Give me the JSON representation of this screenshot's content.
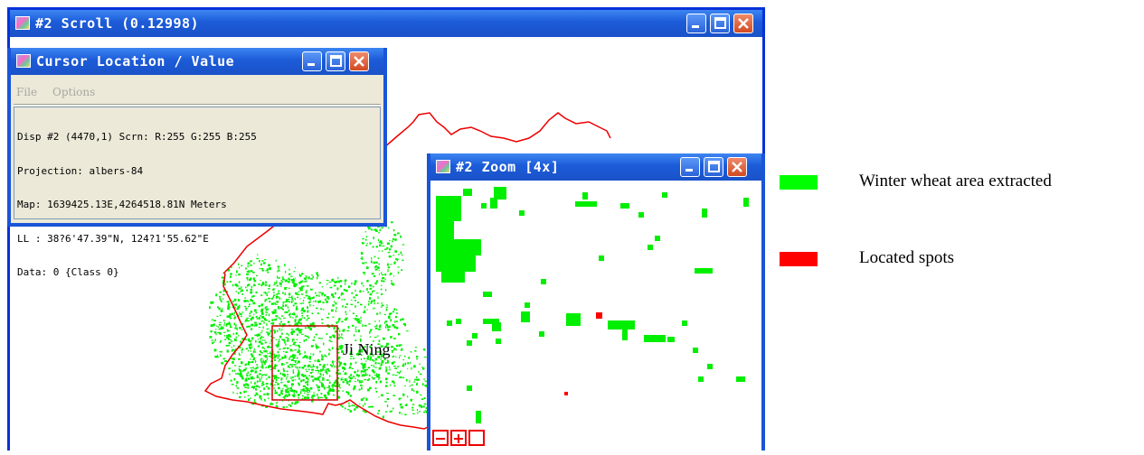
{
  "scroll_window": {
    "title": "#2 Scroll (0.12998)"
  },
  "cursor_window": {
    "title": "Cursor Location / Value",
    "menu": [
      "File",
      "Options"
    ],
    "lines": [
      "Disp #2 (4470,1) Scrn: R:255 G:255 B:255",
      "Projection: albers-84",
      "Map: 1639425.13E,4264518.81N Meters",
      "LL : 38?6'47.39\"N, 124?1'55.62\"E",
      "Data: 0 {Class 0}"
    ]
  },
  "zoom_window": {
    "title": "#2 Zoom [4x]"
  },
  "map_label": "Ji Ning",
  "legend": [
    {
      "label": "Winter wheat area extracted",
      "color": "#00ff00"
    },
    {
      "label": "Located spots",
      "color": "#ff0000"
    }
  ],
  "colors": {
    "boundary": "#ee0000",
    "wheat": "#00ee00",
    "spot": "#ff0000",
    "titlebar": "#1c5bd8",
    "frame": "#0831d9"
  }
}
